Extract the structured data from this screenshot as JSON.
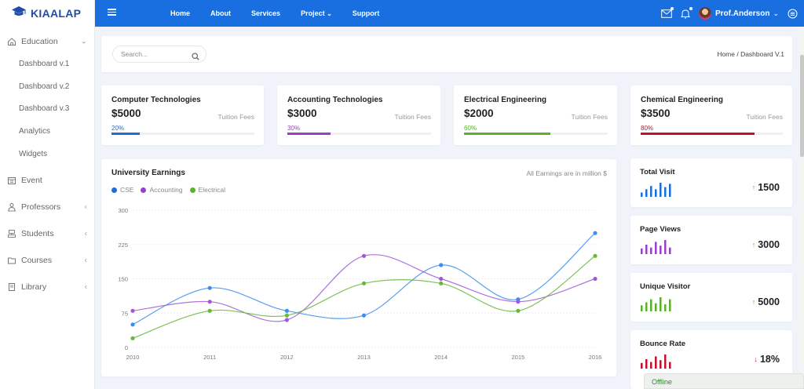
{
  "brand": {
    "name": "KIAALAP",
    "logo_icon": "graduation-cap-icon",
    "color": "#1f4ea8"
  },
  "sidebar": {
    "items": [
      {
        "label": "Education",
        "icon": "home-icon",
        "expanded": true,
        "children": [
          "Dashboard v.1",
          "Dashboard v.2",
          "Dashboard v.3",
          "Analytics",
          "Widgets"
        ]
      },
      {
        "label": "Event",
        "icon": "calendar-icon"
      },
      {
        "label": "Professors",
        "icon": "professor-icon",
        "has_submenu": true
      },
      {
        "label": "Students",
        "icon": "students-icon",
        "has_submenu": true
      },
      {
        "label": "Courses",
        "icon": "courses-icon",
        "has_submenu": true
      },
      {
        "label": "Library",
        "icon": "library-icon",
        "has_submenu": true
      }
    ]
  },
  "header": {
    "background": "#1a6fe0",
    "nav": [
      "Home",
      "About",
      "Services",
      "Project",
      "Support"
    ],
    "user_name": "Prof.Anderson"
  },
  "search": {
    "placeholder": "Search..."
  },
  "breadcrumb": "Home / Dashboard V.1",
  "stats": [
    {
      "title": "Computer Technologies",
      "amount": "$5000",
      "fees_label": "Tuition Fees",
      "percent_label": "20%",
      "percent": 20,
      "color": "#1a6fe0"
    },
    {
      "title": "Accounting Technologies",
      "amount": "$3000",
      "fees_label": "Tuition Fees",
      "percent_label": "30%",
      "percent": 30,
      "color": "#9b3fc9"
    },
    {
      "title": "Electrical Engineering",
      "amount": "$2000",
      "fees_label": "Tuition Fees",
      "percent_label": "60%",
      "percent": 60,
      "color": "#5ab22a"
    },
    {
      "title": "Chemical Engineering",
      "amount": "$3500",
      "fees_label": "Tuition Fees",
      "percent_label": "80%",
      "percent": 80,
      "color": "#c2102e"
    }
  ],
  "earnings": {
    "title": "University Earnings",
    "note": "All Earnings are in million $"
  },
  "chart_data": {
    "type": "line",
    "title": "University Earnings",
    "x": [
      "2010",
      "2011",
      "2012",
      "2013",
      "2014",
      "2015",
      "2016"
    ],
    "series": [
      {
        "name": "CSE",
        "color": "#3a8ef0",
        "values": [
          50,
          130,
          80,
          70,
          180,
          105,
          250
        ]
      },
      {
        "name": "Accounting",
        "color": "#a05ad8",
        "values": [
          80,
          100,
          60,
          200,
          150,
          100,
          150
        ]
      },
      {
        "name": "Electrical",
        "color": "#66b83a",
        "values": [
          20,
          80,
          70,
          140,
          140,
          80,
          200
        ]
      }
    ],
    "yticks": [
      "0",
      "75",
      "150",
      "225",
      "300"
    ],
    "ylim": [
      0,
      300
    ],
    "grid": true,
    "legend": "top-left",
    "smooth": true
  },
  "widgets": [
    {
      "title": "Total Visit",
      "value": "1500",
      "color": "#1a6fe0",
      "trend": "up",
      "bars": [
        4,
        7,
        10,
        7,
        13,
        9,
        12
      ]
    },
    {
      "title": "Page Views",
      "value": "3000",
      "color": "#9b3fc9",
      "trend": "up",
      "bars": [
        6,
        10,
        7,
        13,
        9,
        15,
        7
      ]
    },
    {
      "title": "Unique Visitor",
      "value": "5000",
      "color": "#5ab22a",
      "trend": "up",
      "bars": [
        6,
        9,
        12,
        8,
        14,
        7,
        12
      ]
    },
    {
      "title": "Bounce Rate",
      "value": "18%",
      "color": "#c2102e",
      "trend": "down",
      "bars": [
        6,
        10,
        7,
        13,
        9,
        15,
        7
      ]
    }
  ],
  "status": {
    "offline_label": "Offline"
  }
}
